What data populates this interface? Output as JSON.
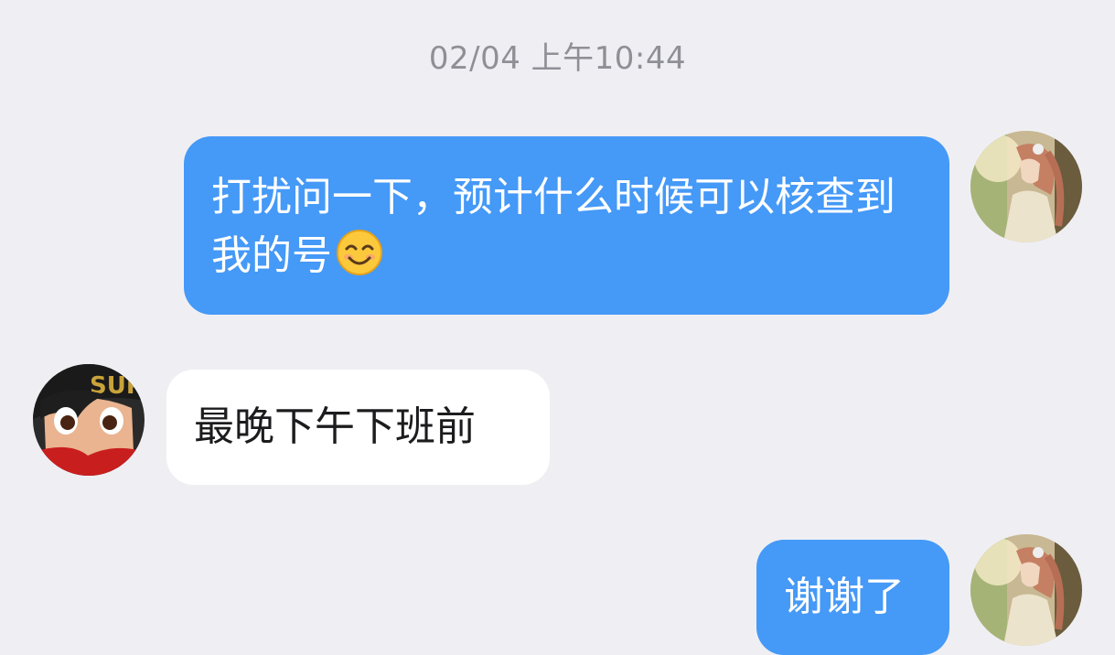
{
  "chat": {
    "timestamp": "02/04 上午10:44",
    "messages": [
      {
        "side": "outgoing",
        "text": "打扰问一下，预计什么时候可以核查到我的号",
        "emoji": "smiling-face-icon"
      },
      {
        "side": "incoming",
        "text": "最晚下午下班前"
      },
      {
        "side": "outgoing",
        "text": "谢谢了"
      }
    ],
    "avatars": {
      "self": "anime-girl-avatar",
      "contact": "anime-boy-avatar"
    }
  },
  "colors": {
    "background": "#efeff3",
    "outgoing_bubble": "#4599f7",
    "incoming_bubble": "#ffffff",
    "timestamp_text": "#8f8f96"
  }
}
